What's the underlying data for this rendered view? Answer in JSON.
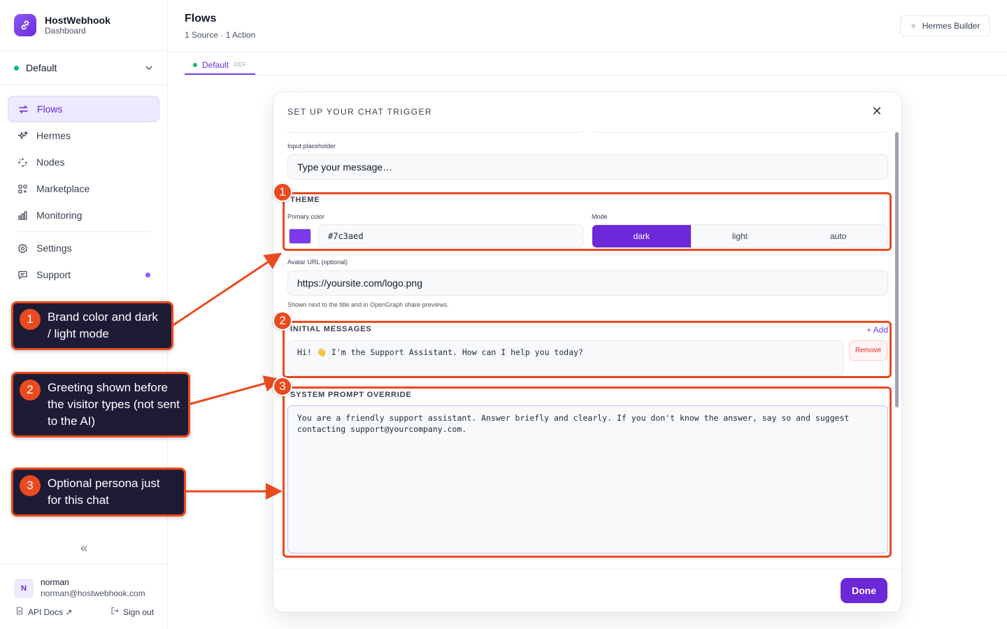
{
  "brand": {
    "name": "HostWebhook",
    "subtitle": "Dashboard"
  },
  "workspace": {
    "name": "Default"
  },
  "nav": {
    "items": [
      {
        "label": "Flows",
        "icon": "arrows-exchange-icon"
      },
      {
        "label": "Hermes",
        "icon": "sparkles-icon"
      },
      {
        "label": "Nodes",
        "icon": "nodes-icon"
      },
      {
        "label": "Marketplace",
        "icon": "grid-icon"
      },
      {
        "label": "Monitoring",
        "icon": "bar-chart-icon"
      },
      {
        "label": "Settings",
        "icon": "gear-icon"
      },
      {
        "label": "Support",
        "icon": "chat-icon"
      }
    ]
  },
  "user": {
    "initial": "N",
    "name": "norman",
    "email": "norman@hostwebhook.com"
  },
  "footer": {
    "api_docs": "API Docs ↗",
    "sign_out": "Sign out"
  },
  "header": {
    "title": "Flows",
    "subtitle": "1 Source · 1 Action",
    "builder_button": "Hermes Builder"
  },
  "tabs": [
    {
      "label": "Default",
      "badge": "DEF"
    }
  ],
  "modal": {
    "title": "SET UP YOUR CHAT TRIGGER",
    "input_placeholder": {
      "label": "Input placeholder",
      "value": "Type your message…"
    },
    "theme": {
      "heading": "THEME",
      "primary_color_label": "Primary color",
      "primary_color": "#7c3aed",
      "mode_label": "Mode",
      "modes": [
        "dark",
        "light",
        "auto"
      ],
      "selected_mode": "dark"
    },
    "avatar": {
      "label": "Avatar URL (optional)",
      "value": "https://yoursite.com/logo.png",
      "hint": "Shown next to the title and in OpenGraph share previews."
    },
    "initial_messages": {
      "heading": "INITIAL MESSAGES",
      "add_label": "+ Add",
      "messages": [
        "Hi! 👋 I'm the Support Assistant. How can I help you today?"
      ],
      "remove_label": "Remove"
    },
    "system_prompt": {
      "heading": "SYSTEM PROMPT OVERRIDE",
      "value": "You are a friendly support assistant. Answer briefly and clearly. If you don't know the answer, say so and suggest\ncontacting support@yourcompany.com."
    },
    "done_label": "Done"
  },
  "annotations": [
    {
      "number": "1",
      "text": "Brand color and dark / light mode"
    },
    {
      "number": "2",
      "text": "Greeting shown before the visitor types (not sent to the AI)"
    },
    {
      "number": "3",
      "text": "Optional persona just for this chat"
    }
  ],
  "colors": {
    "accent": "#6d28d9",
    "annotation": "#ea4a1f",
    "callout_bg": "#1d1b36",
    "status_green": "#10b981"
  }
}
